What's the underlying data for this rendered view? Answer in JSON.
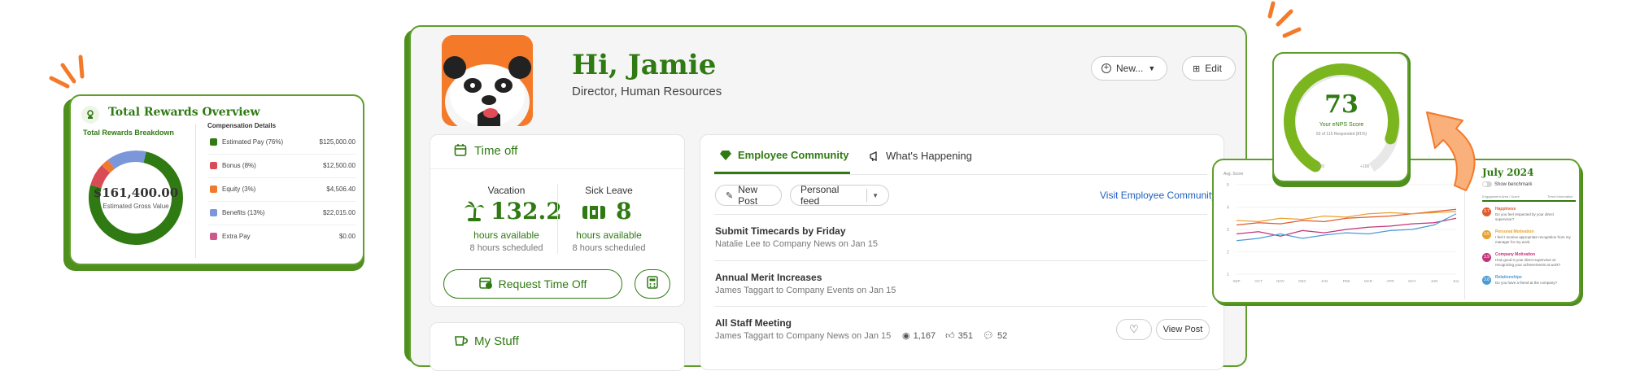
{
  "rewards": {
    "title": "Total Rewards Overview",
    "breakdown_title": "Total Rewards Breakdown",
    "details_title": "Compensation Details",
    "total_value": "$161,400.00",
    "total_label": "Estimated Gross Value",
    "items": [
      {
        "label": "Estimated Pay (76%)",
        "value": "$125,000.00",
        "color": "#2f7a12",
        "fraction": 0.7745
      },
      {
        "label": "Bonus (8%)",
        "value": "$12,500.00",
        "color": "#d94b55",
        "fraction": 0.0774
      },
      {
        "label": "Equity (3%)",
        "value": "$4,506.40",
        "color": "#ef7a2f",
        "fraction": 0.0279
      },
      {
        "label": "Benefits (13%)",
        "value": "$22,015.00",
        "color": "#7b96d9",
        "fraction": 0.1364
      },
      {
        "label": "Extra Pay",
        "value": "$0.00",
        "color": "#c95a8a",
        "fraction": 0.0
      }
    ]
  },
  "profile": {
    "greeting": "Hi, Jamie",
    "job_title": "Director, Human Resources",
    "new_label": "New...",
    "edit_label": "Edit"
  },
  "timeoff": {
    "title": "Time off",
    "vacation_label": "Vacation",
    "vacation_value": "132.2",
    "vacation_available": "hours available",
    "vacation_scheduled": "8 hours scheduled",
    "sick_label": "Sick Leave",
    "sick_value": "8",
    "sick_available": "hours available",
    "sick_scheduled": "8 hours scheduled",
    "request_label": "Request Time Off"
  },
  "mystuff": {
    "title": "My Stuff"
  },
  "community": {
    "tab_community": "Employee Community",
    "tab_happening": "What's Happening",
    "new_post": "New Post",
    "feed_select": "Personal feed",
    "visit_link": "Visit Employee Community",
    "posts": [
      {
        "title": "Submit Timecards by Friday",
        "meta": "Natalie Lee to Company News on Jan 15"
      },
      {
        "title": "Annual Merit Increases",
        "meta": "James Taggart to Company Events on Jan 15"
      },
      {
        "title": "All Staff Meeting",
        "meta": "James Taggart to Company News on Jan 15",
        "views": "1,167",
        "likes": "351",
        "comments": "52",
        "view_post": "View Post"
      }
    ]
  },
  "enps": {
    "score": "73",
    "label": "Your eNPS Score",
    "sub": "93 of 115 Responded (81%)",
    "scale_min": "-100",
    "scale_max": "+100",
    "scale_mid": "0"
  },
  "survey": {
    "month": "July 2024",
    "benchmark_toggle": "Show benchmark",
    "col_left": "Engagement Area / Score",
    "col_right": "Trend Information",
    "axis_label": "Avg. Score",
    "months": [
      "SEP",
      "OCT",
      "NOV",
      "DEC",
      "JAN",
      "FEB",
      "MAR",
      "APR",
      "MAY",
      "JUN",
      "JUL"
    ],
    "y_ticks": [
      "5",
      "4",
      "3",
      "2",
      "1"
    ],
    "categories": [
      {
        "score": "3.7",
        "name": "Happiness",
        "question": "Do you feel respected by your direct supervisor?",
        "color": "#e05a2b"
      },
      {
        "score": "3.5",
        "name": "Personal Motivation",
        "question": "I feel I receive appropriate recognition from my manager for my work.",
        "color": "#e8a22c"
      },
      {
        "score": "3.9",
        "name": "Company Motivation",
        "question": "How good is your direct supervisor at recognizing your achievements at work?",
        "color": "#c2337a"
      },
      {
        "score": "3.8",
        "name": "Relationships",
        "question": "Do you have a friend at the company?",
        "color": "#4a9bd6"
      }
    ]
  },
  "colors": {
    "brand_green": "#2f7a12",
    "accent_orange": "#f47a2a",
    "card_border": "#5f9e2a"
  }
}
